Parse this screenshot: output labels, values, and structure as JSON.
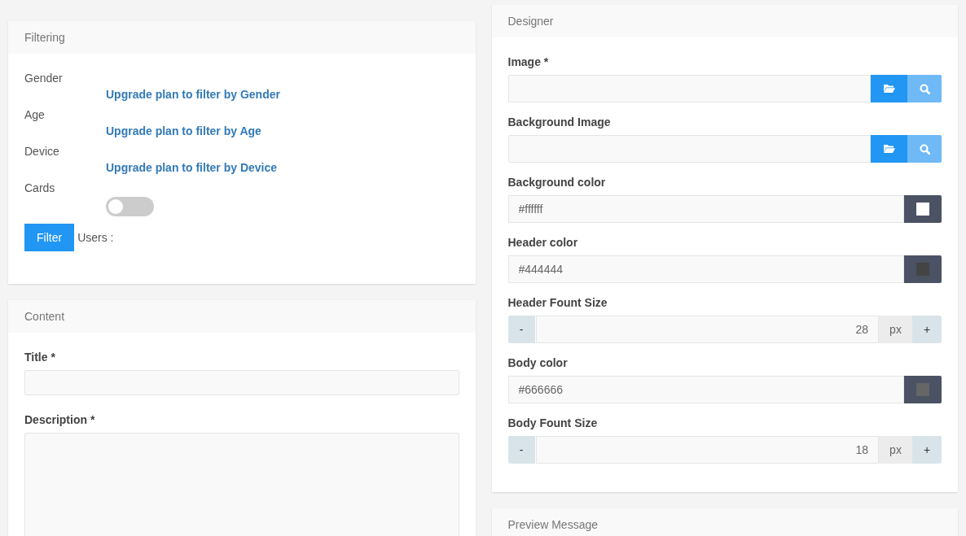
{
  "filtering": {
    "title": "Filtering",
    "filters": [
      {
        "label": "Gender",
        "link": "Upgrade plan to filter by Gender"
      },
      {
        "label": "Age",
        "link": "Upgrade plan to filter by Age"
      },
      {
        "label": "Device",
        "link": "Upgrade plan to filter by Device"
      }
    ],
    "cards": {
      "label": "Cards",
      "on": false
    },
    "filter_button": "Filter",
    "users_label": "Users :"
  },
  "content": {
    "title": "Content",
    "fields": [
      {
        "kind": "text",
        "label": "Title *"
      },
      {
        "kind": "textarea",
        "label": "Description *"
      }
    ]
  },
  "designer": {
    "title": "Designer",
    "fields": [
      {
        "kind": "file",
        "label": "Image *"
      },
      {
        "kind": "file",
        "label": "Background Image"
      },
      {
        "kind": "color",
        "label": "Background color",
        "value": "#ffffff",
        "color": "#ffffff"
      },
      {
        "kind": "color",
        "label": "Header color",
        "value": "#444444",
        "color": "#444444"
      },
      {
        "kind": "number",
        "label": "Header Fount Size",
        "minus": "-",
        "value": "28",
        "unit": "px",
        "plus": "+"
      },
      {
        "kind": "color",
        "label": "Body color",
        "value": "#666666",
        "color": "#666666"
      },
      {
        "kind": "number",
        "label": "Body Fount Size",
        "minus": "-",
        "value": "18",
        "unit": "px",
        "plus": "+"
      }
    ]
  },
  "preview": {
    "title": "Preview Message"
  }
}
